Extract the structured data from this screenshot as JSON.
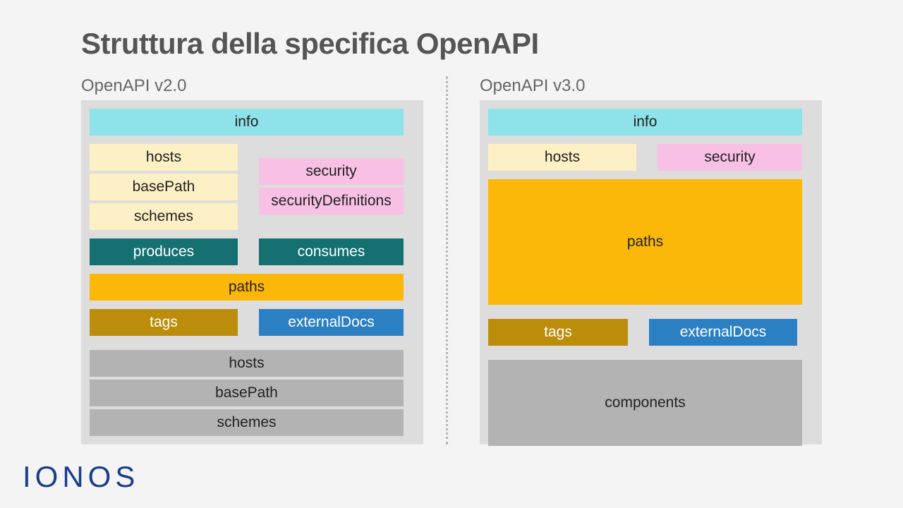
{
  "title": "Struttura della specifica OpenAPI",
  "logo": "IONOS",
  "v2": {
    "label": "OpenAPI v2.0",
    "info": "info",
    "left": [
      "hosts",
      "basePath",
      "schemes"
    ],
    "right": [
      "security",
      "securityDefinitions"
    ],
    "produces": "produces",
    "consumes": "consumes",
    "paths": "paths",
    "tags": "tags",
    "externalDocs": "externalDocs",
    "bottom": [
      "hosts",
      "basePath",
      "schemes"
    ]
  },
  "v3": {
    "label": "OpenAPI v3.0",
    "info": "info",
    "hosts": "hosts",
    "security": "security",
    "paths": "paths",
    "tags": "tags",
    "externalDocs": "externalDocs",
    "components": "components"
  }
}
